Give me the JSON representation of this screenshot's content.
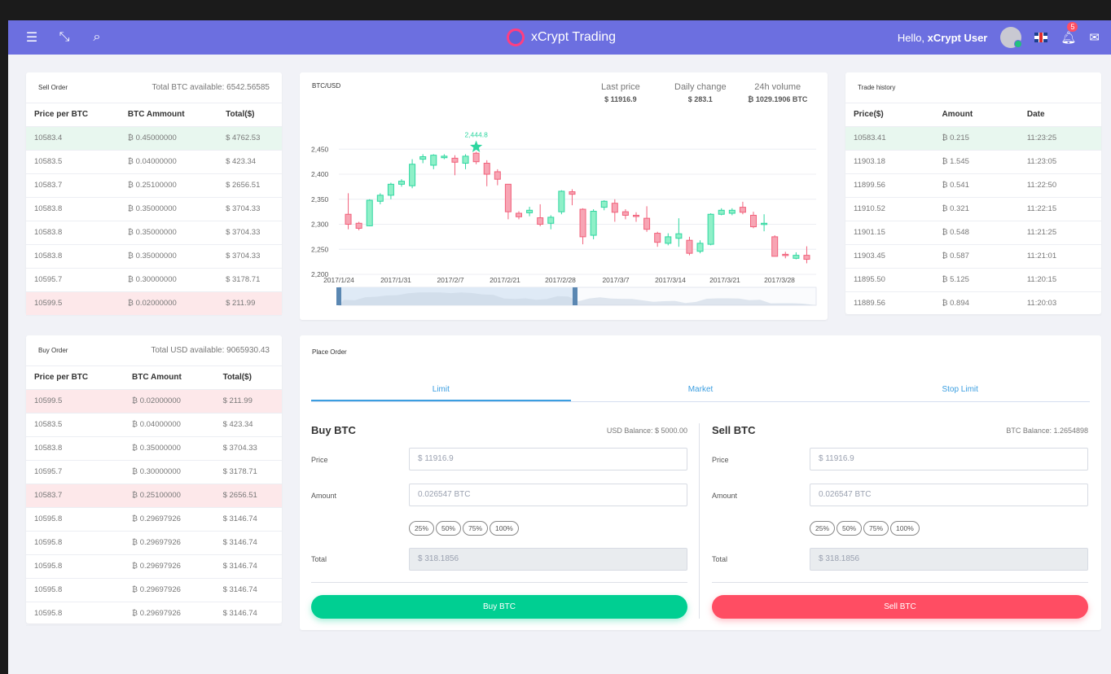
{
  "topbar": {
    "icons": [
      "menu-icon",
      "collapse-icon",
      "search-icon"
    ],
    "brand": "xCrypt Trading",
    "hello_prefix": "Hello, ",
    "user": "xCrypt User",
    "notifications": "5",
    "colors": {
      "bar": "#6c6fe0",
      "buy": "#00cf92",
      "sell": "#ff4d63",
      "up": "#2ed6a0",
      "down": "#f1617b"
    }
  },
  "sell_order": {
    "title": "Sell Order",
    "available": "Total BTC available: 6542.56585",
    "headers": [
      "Price per BTC",
      "BTC Ammount",
      "Total($)"
    ],
    "rows": [
      [
        "10583.4",
        "₿ 0.45000000",
        "$ 4762.53"
      ],
      [
        "10583.5",
        "₿ 0.04000000",
        "$ 423.34"
      ],
      [
        "10583.7",
        "₿ 0.25100000",
        "$ 2656.51"
      ],
      [
        "10583.8",
        "₿ 0.35000000",
        "$ 3704.33"
      ],
      [
        "10583.8",
        "₿ 0.35000000",
        "$ 3704.33"
      ],
      [
        "10583.8",
        "₿ 0.35000000",
        "$ 3704.33"
      ],
      [
        "10595.7",
        "₿ 0.30000000",
        "$ 3178.71"
      ],
      [
        "10599.5",
        "₿ 0.02000000",
        "$ 211.99"
      ]
    ]
  },
  "buy_order": {
    "title": "Buy Order",
    "available": "Total USD available: 9065930.43",
    "headers": [
      "Price per BTC",
      "BTC Amount",
      "Total($)"
    ],
    "rows": [
      [
        "10599.5",
        "₿ 0.02000000",
        "$ 211.99"
      ],
      [
        "10583.5",
        "₿ 0.04000000",
        "$ 423.34"
      ],
      [
        "10583.8",
        "₿ 0.35000000",
        "$ 3704.33"
      ],
      [
        "10595.7",
        "₿ 0.30000000",
        "$ 3178.71"
      ],
      [
        "10583.7",
        "₿ 0.25100000",
        "$ 2656.51"
      ],
      [
        "10595.8",
        "₿ 0.29697926",
        "$ 3146.74"
      ],
      [
        "10595.8",
        "₿ 0.29697926",
        "$ 3146.74"
      ],
      [
        "10595.8",
        "₿ 0.29697926",
        "$ 3146.74"
      ],
      [
        "10595.8",
        "₿ 0.29697926",
        "$ 3146.74"
      ],
      [
        "10595.8",
        "₿ 0.29697926",
        "$ 3146.74"
      ]
    ]
  },
  "trade_history": {
    "title": "Trade history",
    "headers": [
      "Price($)",
      "Amount",
      "Date"
    ],
    "rows": [
      [
        "10583.41",
        "₿ 0.215",
        "11:23:25"
      ],
      [
        "11903.18",
        "₿ 1.545",
        "11:23:05"
      ],
      [
        "11899.56",
        "₿ 0.541",
        "11:22:50"
      ],
      [
        "11910.52",
        "₿ 0.321",
        "11:22:15"
      ],
      [
        "11901.15",
        "₿ 0.548",
        "11:21:25"
      ],
      [
        "11903.45",
        "₿ 0.587",
        "11:21:01"
      ],
      [
        "11895.50",
        "₿ 5.125",
        "11:20:15"
      ],
      [
        "11889.56",
        "₿ 0.894",
        "11:20:03"
      ]
    ]
  },
  "market": {
    "pair": "BTC/USD",
    "last_price_label": "Last price",
    "last_price": "$ 11916.9",
    "daily_change_label": "Daily change",
    "daily_change": "$ 283.1",
    "volume_label": "24h volume",
    "volume": "₿ 1029.1906 BTC"
  },
  "chart_data": {
    "type": "candlestick",
    "ylim": [
      2200,
      2470
    ],
    "yticks": [
      "2,450",
      "2,400",
      "2,350",
      "2,300",
      "2,250",
      "2,200"
    ],
    "xticks": [
      "2017/1/24",
      "2017/1/31",
      "2017/2/7",
      "2017/2/21",
      "2017/2/28",
      "2017/3/7",
      "2017/3/14",
      "2017/3/21",
      "2017/3/28"
    ],
    "max_marker": "2,444.8",
    "candles": [
      {
        "o": 2320,
        "c": 2300,
        "h": 2362,
        "l": 2290
      },
      {
        "o": 2302,
        "c": 2292,
        "h": 2305,
        "l": 2288
      },
      {
        "o": 2297,
        "c": 2348,
        "h": 2350,
        "l": 2296
      },
      {
        "o": 2346,
        "c": 2358,
        "h": 2362,
        "l": 2340
      },
      {
        "o": 2358,
        "c": 2380,
        "h": 2383,
        "l": 2350
      },
      {
        "o": 2380,
        "c": 2386,
        "h": 2390,
        "l": 2375
      },
      {
        "o": 2377,
        "c": 2420,
        "h": 2430,
        "l": 2372
      },
      {
        "o": 2430,
        "c": 2435,
        "h": 2440,
        "l": 2422
      },
      {
        "o": 2418,
        "c": 2438,
        "h": 2440,
        "l": 2410
      },
      {
        "o": 2433,
        "c": 2436,
        "h": 2440,
        "l": 2430
      },
      {
        "o": 2432,
        "c": 2424,
        "h": 2438,
        "l": 2398
      },
      {
        "o": 2422,
        "c": 2436,
        "h": 2440,
        "l": 2410
      },
      {
        "o": 2442,
        "c": 2425,
        "h": 2444.8,
        "l": 2420
      },
      {
        "o": 2422,
        "c": 2400,
        "h": 2428,
        "l": 2376
      },
      {
        "o": 2405,
        "c": 2390,
        "h": 2410,
        "l": 2378
      },
      {
        "o": 2380,
        "c": 2325,
        "h": 2380,
        "l": 2310
      },
      {
        "o": 2322,
        "c": 2315,
        "h": 2326,
        "l": 2310
      },
      {
        "o": 2323,
        "c": 2328,
        "h": 2335,
        "l": 2316
      },
      {
        "o": 2313,
        "c": 2300,
        "h": 2340,
        "l": 2296
      },
      {
        "o": 2302,
        "c": 2314,
        "h": 2318,
        "l": 2290
      },
      {
        "o": 2325,
        "c": 2366,
        "h": 2368,
        "l": 2320
      },
      {
        "o": 2365,
        "c": 2360,
        "h": 2370,
        "l": 2338
      },
      {
        "o": 2330,
        "c": 2275,
        "h": 2332,
        "l": 2260
      },
      {
        "o": 2278,
        "c": 2326,
        "h": 2330,
        "l": 2270
      },
      {
        "o": 2334,
        "c": 2346,
        "h": 2348,
        "l": 2328
      },
      {
        "o": 2342,
        "c": 2324,
        "h": 2350,
        "l": 2305
      },
      {
        "o": 2325,
        "c": 2318,
        "h": 2330,
        "l": 2310
      },
      {
        "o": 2318,
        "c": 2316,
        "h": 2324,
        "l": 2305
      },
      {
        "o": 2312,
        "c": 2290,
        "h": 2336,
        "l": 2285
      },
      {
        "o": 2282,
        "c": 2264,
        "h": 2285,
        "l": 2255
      },
      {
        "o": 2262,
        "c": 2275,
        "h": 2282,
        "l": 2258
      },
      {
        "o": 2272,
        "c": 2281,
        "h": 2312,
        "l": 2255
      },
      {
        "o": 2268,
        "c": 2242,
        "h": 2275,
        "l": 2238
      },
      {
        "o": 2246,
        "c": 2262,
        "h": 2268,
        "l": 2242
      },
      {
        "o": 2260,
        "c": 2320,
        "h": 2322,
        "l": 2258
      },
      {
        "o": 2320,
        "c": 2328,
        "h": 2332,
        "l": 2318
      },
      {
        "o": 2322,
        "c": 2328,
        "h": 2332,
        "l": 2318
      },
      {
        "o": 2334,
        "c": 2324,
        "h": 2345,
        "l": 2320
      },
      {
        "o": 2318,
        "c": 2295,
        "h": 2325,
        "l": 2292
      },
      {
        "o": 2300,
        "c": 2302,
        "h": 2320,
        "l": 2286
      },
      {
        "o": 2275,
        "c": 2236,
        "h": 2278,
        "l": 2236
      },
      {
        "o": 2240,
        "c": 2238,
        "h": 2245,
        "l": 2232
      },
      {
        "o": 2232,
        "c": 2238,
        "h": 2244,
        "l": 2230
      },
      {
        "o": 2238,
        "c": 2230,
        "h": 2256,
        "l": 2222
      }
    ]
  },
  "place_order": {
    "title": "Place Order",
    "tabs": [
      "Limit",
      "Market",
      "Stop Limit"
    ],
    "buy": {
      "title": "Buy BTC",
      "balance": "USD Balance: $ 5000.00",
      "price_label": "Price",
      "price": "$ 11916.9",
      "amount_label": "Amount",
      "amount": "0.026547 BTC",
      "pcts": [
        "25%",
        "50%",
        "75%",
        "100%"
      ],
      "total_label": "Total",
      "total": "$ 318.1856",
      "button": "Buy BTC"
    },
    "sell": {
      "title": "Sell BTC",
      "balance": "BTC Balance: 1.2654898",
      "price_label": "Price",
      "price": "$ 11916.9",
      "amount_label": "Amount",
      "amount": "0.026547 BTC",
      "pcts": [
        "25%",
        "50%",
        "75%",
        "100%"
      ],
      "total_label": "Total",
      "total": "$ 318.1856",
      "button": "Sell BTC"
    }
  }
}
